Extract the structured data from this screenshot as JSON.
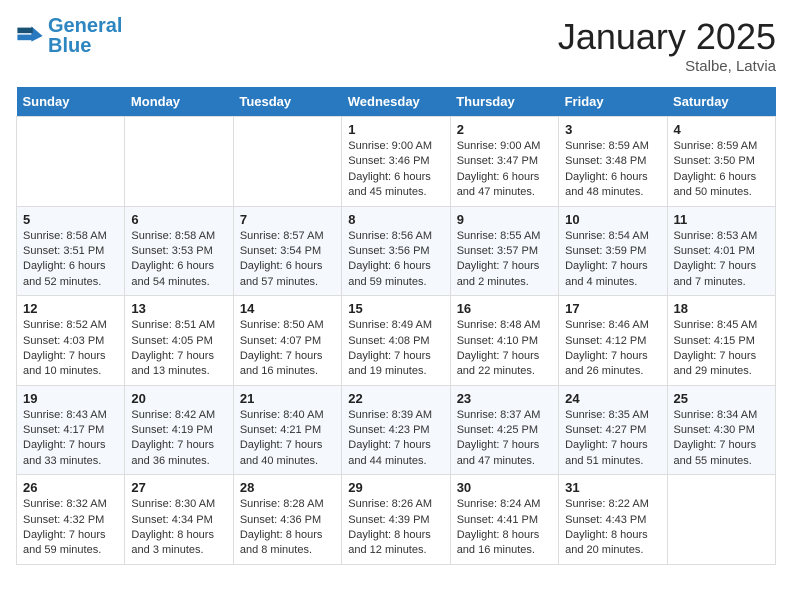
{
  "header": {
    "logo_text1": "General",
    "logo_text2": "Blue",
    "month": "January 2025",
    "location": "Stalbe, Latvia"
  },
  "days_of_week": [
    "Sunday",
    "Monday",
    "Tuesday",
    "Wednesday",
    "Thursday",
    "Friday",
    "Saturday"
  ],
  "weeks": [
    [
      {
        "day": "",
        "sunrise": "",
        "sunset": "",
        "daylight": ""
      },
      {
        "day": "",
        "sunrise": "",
        "sunset": "",
        "daylight": ""
      },
      {
        "day": "",
        "sunrise": "",
        "sunset": "",
        "daylight": ""
      },
      {
        "day": "1",
        "sunrise": "Sunrise: 9:00 AM",
        "sunset": "Sunset: 3:46 PM",
        "daylight": "Daylight: 6 hours and 45 minutes."
      },
      {
        "day": "2",
        "sunrise": "Sunrise: 9:00 AM",
        "sunset": "Sunset: 3:47 PM",
        "daylight": "Daylight: 6 hours and 47 minutes."
      },
      {
        "day": "3",
        "sunrise": "Sunrise: 8:59 AM",
        "sunset": "Sunset: 3:48 PM",
        "daylight": "Daylight: 6 hours and 48 minutes."
      },
      {
        "day": "4",
        "sunrise": "Sunrise: 8:59 AM",
        "sunset": "Sunset: 3:50 PM",
        "daylight": "Daylight: 6 hours and 50 minutes."
      }
    ],
    [
      {
        "day": "5",
        "sunrise": "Sunrise: 8:58 AM",
        "sunset": "Sunset: 3:51 PM",
        "daylight": "Daylight: 6 hours and 52 minutes."
      },
      {
        "day": "6",
        "sunrise": "Sunrise: 8:58 AM",
        "sunset": "Sunset: 3:53 PM",
        "daylight": "Daylight: 6 hours and 54 minutes."
      },
      {
        "day": "7",
        "sunrise": "Sunrise: 8:57 AM",
        "sunset": "Sunset: 3:54 PM",
        "daylight": "Daylight: 6 hours and 57 minutes."
      },
      {
        "day": "8",
        "sunrise": "Sunrise: 8:56 AM",
        "sunset": "Sunset: 3:56 PM",
        "daylight": "Daylight: 6 hours and 59 minutes."
      },
      {
        "day": "9",
        "sunrise": "Sunrise: 8:55 AM",
        "sunset": "Sunset: 3:57 PM",
        "daylight": "Daylight: 7 hours and 2 minutes."
      },
      {
        "day": "10",
        "sunrise": "Sunrise: 8:54 AM",
        "sunset": "Sunset: 3:59 PM",
        "daylight": "Daylight: 7 hours and 4 minutes."
      },
      {
        "day": "11",
        "sunrise": "Sunrise: 8:53 AM",
        "sunset": "Sunset: 4:01 PM",
        "daylight": "Daylight: 7 hours and 7 minutes."
      }
    ],
    [
      {
        "day": "12",
        "sunrise": "Sunrise: 8:52 AM",
        "sunset": "Sunset: 4:03 PM",
        "daylight": "Daylight: 7 hours and 10 minutes."
      },
      {
        "day": "13",
        "sunrise": "Sunrise: 8:51 AM",
        "sunset": "Sunset: 4:05 PM",
        "daylight": "Daylight: 7 hours and 13 minutes."
      },
      {
        "day": "14",
        "sunrise": "Sunrise: 8:50 AM",
        "sunset": "Sunset: 4:07 PM",
        "daylight": "Daylight: 7 hours and 16 minutes."
      },
      {
        "day": "15",
        "sunrise": "Sunrise: 8:49 AM",
        "sunset": "Sunset: 4:08 PM",
        "daylight": "Daylight: 7 hours and 19 minutes."
      },
      {
        "day": "16",
        "sunrise": "Sunrise: 8:48 AM",
        "sunset": "Sunset: 4:10 PM",
        "daylight": "Daylight: 7 hours and 22 minutes."
      },
      {
        "day": "17",
        "sunrise": "Sunrise: 8:46 AM",
        "sunset": "Sunset: 4:12 PM",
        "daylight": "Daylight: 7 hours and 26 minutes."
      },
      {
        "day": "18",
        "sunrise": "Sunrise: 8:45 AM",
        "sunset": "Sunset: 4:15 PM",
        "daylight": "Daylight: 7 hours and 29 minutes."
      }
    ],
    [
      {
        "day": "19",
        "sunrise": "Sunrise: 8:43 AM",
        "sunset": "Sunset: 4:17 PM",
        "daylight": "Daylight: 7 hours and 33 minutes."
      },
      {
        "day": "20",
        "sunrise": "Sunrise: 8:42 AM",
        "sunset": "Sunset: 4:19 PM",
        "daylight": "Daylight: 7 hours and 36 minutes."
      },
      {
        "day": "21",
        "sunrise": "Sunrise: 8:40 AM",
        "sunset": "Sunset: 4:21 PM",
        "daylight": "Daylight: 7 hours and 40 minutes."
      },
      {
        "day": "22",
        "sunrise": "Sunrise: 8:39 AM",
        "sunset": "Sunset: 4:23 PM",
        "daylight": "Daylight: 7 hours and 44 minutes."
      },
      {
        "day": "23",
        "sunrise": "Sunrise: 8:37 AM",
        "sunset": "Sunset: 4:25 PM",
        "daylight": "Daylight: 7 hours and 47 minutes."
      },
      {
        "day": "24",
        "sunrise": "Sunrise: 8:35 AM",
        "sunset": "Sunset: 4:27 PM",
        "daylight": "Daylight: 7 hours and 51 minutes."
      },
      {
        "day": "25",
        "sunrise": "Sunrise: 8:34 AM",
        "sunset": "Sunset: 4:30 PM",
        "daylight": "Daylight: 7 hours and 55 minutes."
      }
    ],
    [
      {
        "day": "26",
        "sunrise": "Sunrise: 8:32 AM",
        "sunset": "Sunset: 4:32 PM",
        "daylight": "Daylight: 7 hours and 59 minutes."
      },
      {
        "day": "27",
        "sunrise": "Sunrise: 8:30 AM",
        "sunset": "Sunset: 4:34 PM",
        "daylight": "Daylight: 8 hours and 3 minutes."
      },
      {
        "day": "28",
        "sunrise": "Sunrise: 8:28 AM",
        "sunset": "Sunset: 4:36 PM",
        "daylight": "Daylight: 8 hours and 8 minutes."
      },
      {
        "day": "29",
        "sunrise": "Sunrise: 8:26 AM",
        "sunset": "Sunset: 4:39 PM",
        "daylight": "Daylight: 8 hours and 12 minutes."
      },
      {
        "day": "30",
        "sunrise": "Sunrise: 8:24 AM",
        "sunset": "Sunset: 4:41 PM",
        "daylight": "Daylight: 8 hours and 16 minutes."
      },
      {
        "day": "31",
        "sunrise": "Sunrise: 8:22 AM",
        "sunset": "Sunset: 4:43 PM",
        "daylight": "Daylight: 8 hours and 20 minutes."
      },
      {
        "day": "",
        "sunrise": "",
        "sunset": "",
        "daylight": ""
      }
    ]
  ]
}
